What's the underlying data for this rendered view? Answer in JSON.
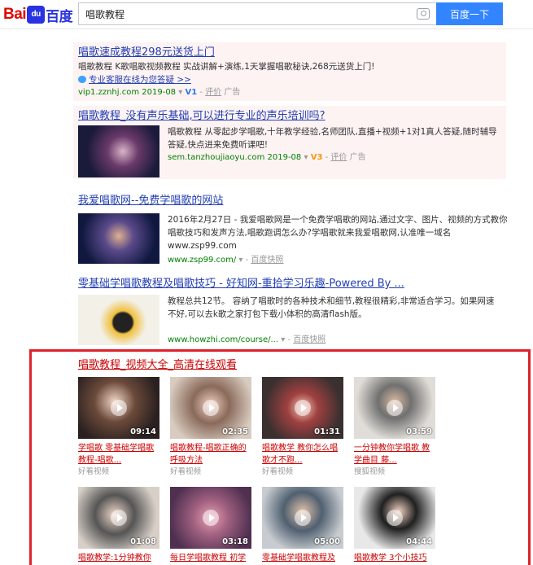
{
  "header": {
    "logo_left": "Bai",
    "logo_mid": "du",
    "logo_right": "百度",
    "query": "唱歌教程",
    "search_button": "百度一下",
    "camera_icon": "camera-icon"
  },
  "results": [
    {
      "title": "唱歌速成教程298元送货上门",
      "desc": "唱歌教程 K歌唱歌视频教程 实战讲解+演练,1天掌握唱歌秘诀,268元送货上门!",
      "extra_link": "专业客服在线为您答疑 >>",
      "url": "vip1.zznhj.com",
      "date": "2019-08",
      "v_badge": "V1",
      "comment": "评价",
      "ad": "广告"
    },
    {
      "title": "唱歌教程_没有声乐基础,可以进行专业的声乐培训吗?",
      "desc": "唱歌教程 从零起步学唱歌,十年教学经验,名师团队,直播+视频+1对1真人答疑,随时辅导答疑,快点进来免费听课吧!",
      "url": "sem.tanzhoujiaoyu.com",
      "date": "2019-08",
      "v_badge": "V3",
      "comment": "评价",
      "ad": "广告"
    },
    {
      "title": "我爱唱歌网--免费学唱歌的网站",
      "desc": "2016年2月27日 - 我爱唱歌网是一个免费学唱歌的网站,通过文字、图片、视频的方式教你唱歌技巧和发声方法,唱歌跑调怎么办?学唱歌就来我爱唱歌网,认准唯一域名www.zsp99.com",
      "url": "www.zsp99.com/",
      "cache": "百度快照"
    },
    {
      "title": "零基础学唱歌教程及唱歌技巧 - 好知网-重拾学习乐趣-Powered By ...",
      "desc": "教程总共12节。 容纳了唱歌时的各种技术和细节,教程很精彩,非常适合学习。如果网速不好,可以去k歌之家打包下载小体积的高清flash版。",
      "url": "www.howzhi.com/course/...",
      "cache": "百度快照"
    }
  ],
  "video_section": {
    "title": "唱歌教程_视频大全_高清在线观看",
    "videos": [
      {
        "duration": "09:14",
        "title": "学唱歌 零基础学唱歌教程-唱歌...",
        "source": "好看视频"
      },
      {
        "duration": "02:35",
        "title": "唱歌教程-唱歌正确的呼吸方法",
        "source": "好看视频"
      },
      {
        "duration": "01:31",
        "title": "唱歌教学 教你怎么唱歌才不跑...",
        "source": "好看视频"
      },
      {
        "duration": "03:59",
        "title": "一分钟教你学唱歌 教学曲目 藤...",
        "source": "搜狐视频"
      },
      {
        "duration": "01:08",
        "title": "唱歌教学:1分钟教你",
        "source": ""
      },
      {
        "duration": "03:18",
        "title": "每日学唱歌教程 初学",
        "source": ""
      },
      {
        "duration": "05:00",
        "title": "零基础学唱歌教程及",
        "source": ""
      },
      {
        "duration": "04:44",
        "title": "唱歌教学 3个小技巧",
        "source": ""
      }
    ]
  },
  "colors": {
    "link": "#2440b3",
    "highlight": "#c00000",
    "url_green": "#008000",
    "box_border": "#e0212b",
    "button": "#3385ff"
  }
}
